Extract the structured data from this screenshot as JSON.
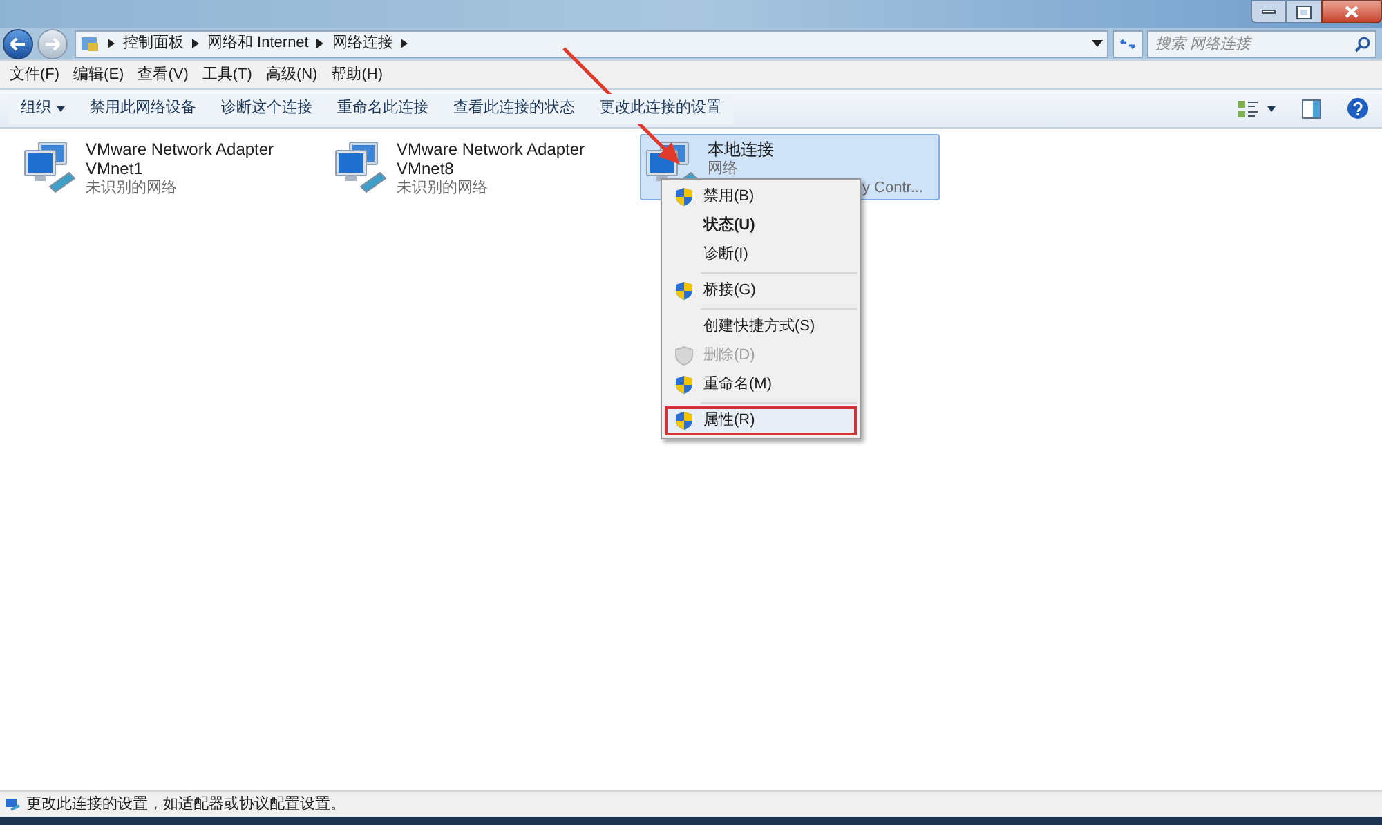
{
  "address": {
    "crumbs": [
      "控制面板",
      "网络和 Internet",
      "网络连接"
    ]
  },
  "search": {
    "placeholder": "搜索 网络连接"
  },
  "menu_bar": [
    "文件(F)",
    "编辑(E)",
    "查看(V)",
    "工具(T)",
    "高级(N)",
    "帮助(H)"
  ],
  "toolbar": [
    {
      "label": "组织",
      "dropdown": true
    },
    {
      "label": "禁用此网络设备",
      "dropdown": false
    },
    {
      "label": "诊断这个连接",
      "dropdown": false
    },
    {
      "label": "重命名此连接",
      "dropdown": false
    },
    {
      "label": "查看此连接的状态",
      "dropdown": false
    },
    {
      "label": "更改此连接的设置",
      "dropdown": false
    }
  ],
  "connections": [
    {
      "name": "VMware Network Adapter VMnet1",
      "status": "未识别的网络",
      "selected": false
    },
    {
      "name": "VMware Network Adapter VMnet8",
      "status": "未识别的网络",
      "selected": false
    },
    {
      "name": "本地连接",
      "status": "网络",
      "device": "y Contr...",
      "selected": true
    }
  ],
  "context_menu": {
    "groups": [
      [
        {
          "label": "禁用(B)",
          "shield": true,
          "bold": false,
          "disabled": false,
          "selected": false
        },
        {
          "label": "状态(U)",
          "shield": false,
          "bold": true,
          "disabled": false,
          "selected": false
        },
        {
          "label": "诊断(I)",
          "shield": false,
          "bold": false,
          "disabled": false,
          "selected": false
        }
      ],
      [
        {
          "label": "桥接(G)",
          "shield": true,
          "bold": false,
          "disabled": false,
          "selected": false
        }
      ],
      [
        {
          "label": "创建快捷方式(S)",
          "shield": false,
          "bold": false,
          "disabled": false,
          "selected": false
        },
        {
          "label": "删除(D)",
          "shield": true,
          "bold": false,
          "disabled": true,
          "selected": false
        },
        {
          "label": "重命名(M)",
          "shield": true,
          "bold": false,
          "disabled": false,
          "selected": false
        }
      ],
      [
        {
          "label": "属性(R)",
          "shield": true,
          "bold": false,
          "disabled": false,
          "selected": true
        }
      ]
    ]
  },
  "status_bar": {
    "text": "更改此连接的设置，如适配器或协议配置设置。"
  }
}
